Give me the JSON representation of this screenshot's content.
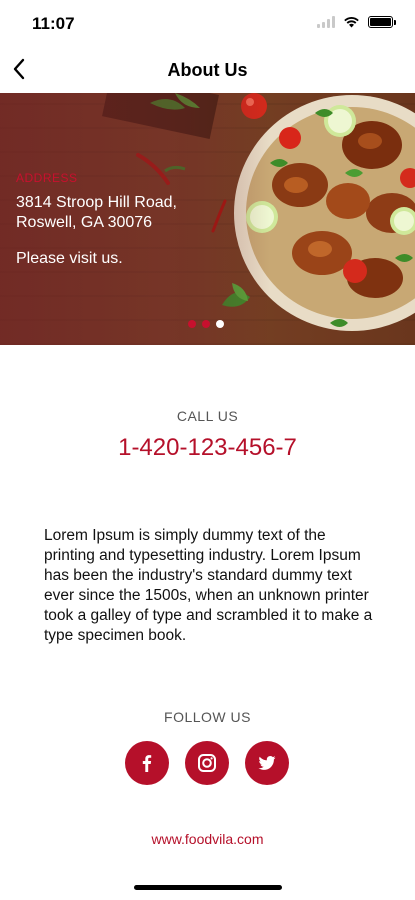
{
  "status_bar": {
    "time": "11:07"
  },
  "nav": {
    "title": "About Us"
  },
  "hero": {
    "address_label": "ADDRESS",
    "address_line1": "3814 Stroop Hill Road,",
    "address_line2": "Roswell, GA 30076",
    "visit_text": "Please visit us.",
    "active_slide": 3,
    "slide_count": 3
  },
  "contact": {
    "call_label": "CALL US",
    "phone": "1-420-123-456-7"
  },
  "description": "Lorem Ipsum is simply dummy text of the printing and typesetting industry. Lorem Ipsum has been the industry's standard dummy text ever since the 1500s, when an unknown printer took a galley of type and scrambled it to make a type specimen book.",
  "social": {
    "follow_label": "FOLLOW US",
    "buttons": [
      "facebook-icon",
      "instagram-icon",
      "twitter-icon"
    ]
  },
  "website": "www.foodvila.com",
  "colors": {
    "accent": "#b5102a",
    "address_label": "#c8102e"
  }
}
